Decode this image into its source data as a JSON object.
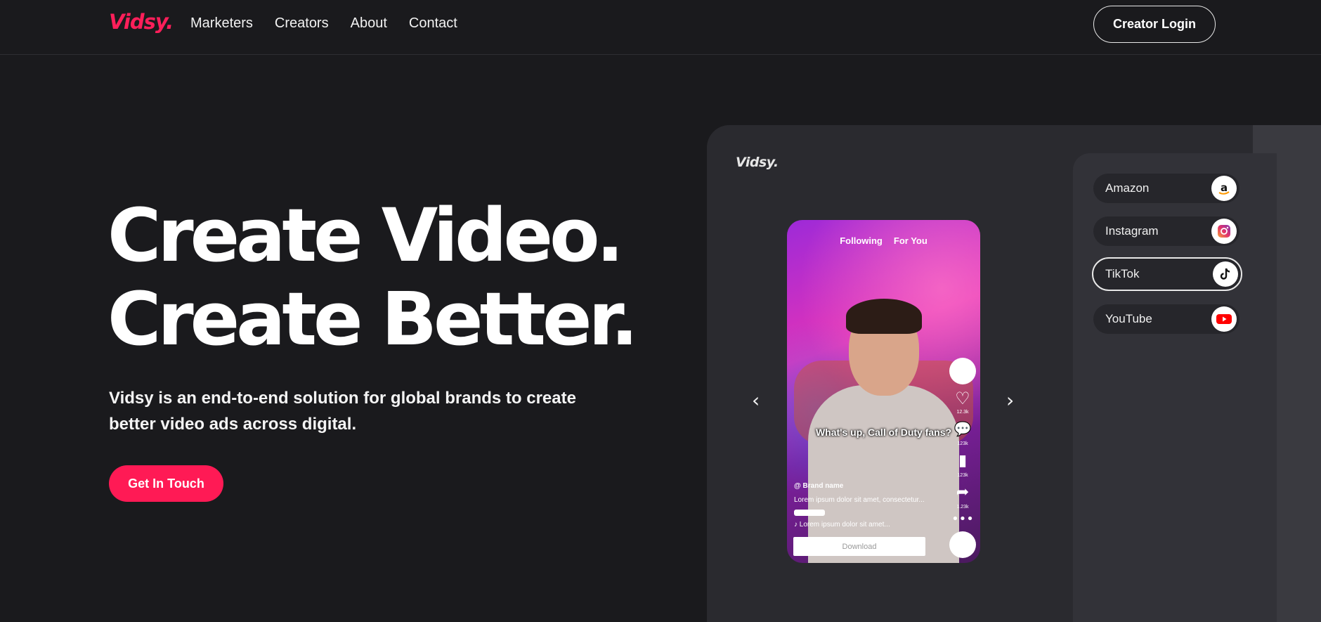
{
  "nav": {
    "logo": "Vidsy.",
    "links": [
      "Marketers",
      "Creators",
      "About",
      "Contact"
    ],
    "login_label": "Creator Login"
  },
  "hero": {
    "title_line1": "Create Video.",
    "title_line2": "Create Better.",
    "subtitle": "Vidsy is an end-to-end solution for global brands to create better video ads across digital.",
    "cta_label": "Get In Touch"
  },
  "demo": {
    "panel_logo": "Vidsy.",
    "platforms": [
      {
        "label": "Amazon",
        "icon": "amazon-icon",
        "active": false
      },
      {
        "label": "Instagram",
        "icon": "instagram-icon",
        "active": false
      },
      {
        "label": "TikTok",
        "icon": "tiktok-icon",
        "active": true
      },
      {
        "label": "YouTube",
        "icon": "youtube-icon",
        "active": false
      }
    ],
    "phone": {
      "tab_following": "Following",
      "tab_for_you": "For You",
      "caption": "What's up, Call of Duty fans?",
      "brand": "@ Brand name",
      "description": "Lorem ipsum dolor sit amet, consectetur...",
      "music": "Lorem ipsum dolor sit amet...",
      "download_label": "Download",
      "like_count": "12.3k",
      "comment_count": "123k",
      "save_count": "123k",
      "share_count": "1.23k"
    }
  },
  "colors": {
    "accent": "#ff1a55",
    "background": "#1a1a1d",
    "panel": "#2a2a2f"
  }
}
